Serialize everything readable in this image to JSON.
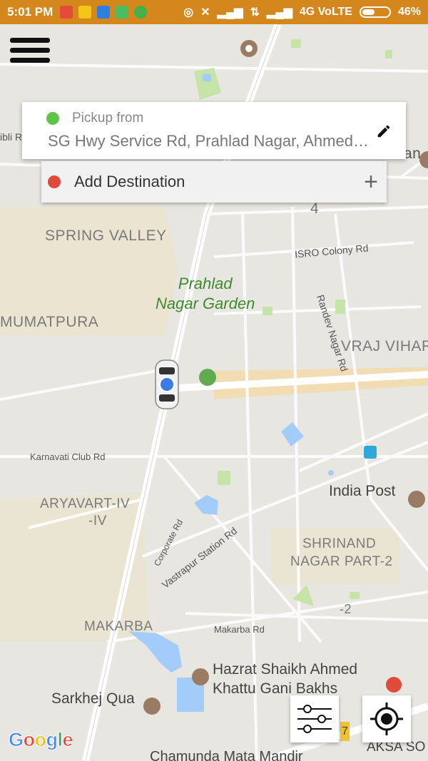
{
  "status_bar": {
    "time": "5:01 PM",
    "network": "4G VoLTE",
    "battery": "46%",
    "battery_level": 0.46
  },
  "pickup": {
    "label": "Pickup from",
    "address": "SG Hwy Service Rd, Prahlad Nagar, Ahmedabad",
    "dot_color": "#5ec44a"
  },
  "destination": {
    "label": "Add Destination",
    "dot_color": "#e04a3b",
    "add_icon": "plus-icon"
  },
  "map": {
    "areas": [
      "SPRING VALLEY",
      "MUMATPURA",
      "VRAJ VIHAR",
      "ARYAVART-IV",
      "-IV",
      "SHRINAND",
      "NAGAR PART-2",
      "MAKARBA",
      "-2",
      "4"
    ],
    "park": [
      "Prahlad",
      "Nagar Garden"
    ],
    "roads": [
      "ISRO Colony Rd",
      "Randev Nagar Rd",
      "Karnavati Club Rd",
      "Corporate Rd",
      "Vastrapur Station Rd",
      "Makarba Rd"
    ],
    "places": [
      "India Post",
      "Hazrat Shaikh Ahmed",
      "Khattu Gani Bakhs",
      "Sarkhej Qua",
      "Chamunda Mata Mandir",
      "AKSA SO"
    ],
    "edge_labels": [
      "ibli R",
      "an",
      "7"
    ],
    "attribution": "Google"
  },
  "colors": {
    "status_bar": "#d4871c",
    "accent_blue": "#3d7be6",
    "park_green": "#3f8a2e"
  }
}
